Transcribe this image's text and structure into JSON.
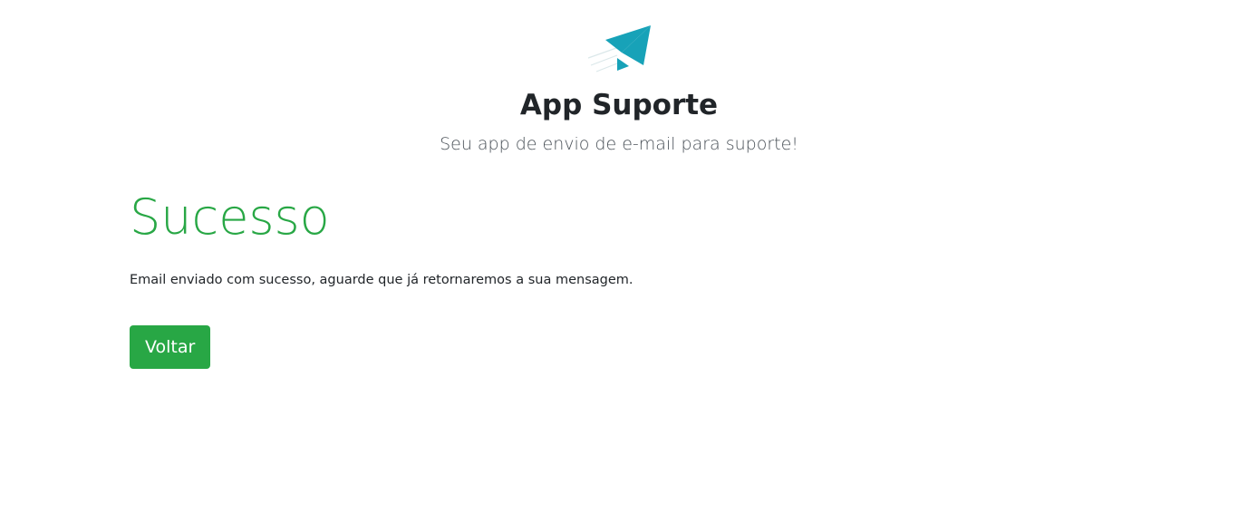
{
  "header": {
    "logo_icon": "paper-plane-icon",
    "title": "App Suporte",
    "subtitle": "Seu app de envio de e-mail para suporte!"
  },
  "main": {
    "heading": "Sucesso",
    "message": "Email enviado com sucesso, aguarde que já retornaremos a sua mensagem.",
    "back_button_label": "Voltar"
  },
  "colors": {
    "success": "#28a745",
    "logo": "#17a2b8",
    "text": "#212529",
    "muted_text": "#495057"
  }
}
